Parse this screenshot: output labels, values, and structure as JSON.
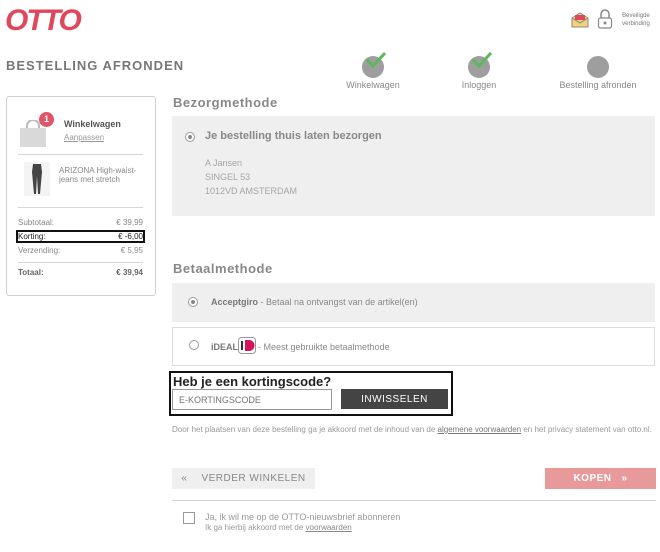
{
  "brand": {
    "logo_text": "OTTO",
    "color": "#e0475a"
  },
  "header": {
    "page_title": "BESTELLING AFRONDEN",
    "secure_label": "Beveiligde verbinding",
    "icons": [
      "mail-icon",
      "lock-icon"
    ]
  },
  "steps": [
    {
      "label": "Winkelwagen",
      "done": true
    },
    {
      "label": "Inloggen",
      "done": true
    },
    {
      "label": "Bestelling afronden",
      "done": false
    }
  ],
  "cart": {
    "badge": "1",
    "title": "Winkelwagen",
    "edit_link": "Aanpassen",
    "product": {
      "name": "ARIZONA High-waist-jeans met stretch"
    },
    "summary": [
      {
        "label": "Subtotaal:",
        "value": "€ 39,99"
      },
      {
        "label": "Korting:",
        "value": "€ -6,00"
      },
      {
        "label": "Verzending:",
        "value": "€ 5,95"
      }
    ],
    "total": {
      "label": "Totaal:",
      "value": "€ 39,94"
    }
  },
  "delivery": {
    "heading": "Bezorgmethode",
    "option_title": "Je bestelling thuis laten bezorgen",
    "address": [
      "A Jansen",
      "SINGEL 53",
      "1012VD AMSTERDAM"
    ]
  },
  "payment": {
    "heading": "Betaalmethode",
    "options": [
      {
        "name": "Acceptgiro",
        "desc": " - Betaal na ontvangst van de artikel(en)",
        "selected": true
      },
      {
        "name": "iDEAL",
        "desc": " - Meest gebruikte betaalmethode",
        "selected": false
      }
    ]
  },
  "coupon": {
    "title": "Heb je een kortingscode?",
    "placeholder": "E-KORTINGSCODE",
    "button": "INWISSELEN"
  },
  "terms": {
    "before": "Door het plaatsen van deze bestelling ga je akkoord met de inhoud van de ",
    "link": "algemene voorwaarden",
    "after": " en het privacy statement van otto.nl."
  },
  "actions": {
    "back": "VERDER WINKELEN",
    "buy": "KOPEN",
    "buy_color": "#e89a9a"
  },
  "newsletter": {
    "label": "Ja, ik wil me op de OTTO-nieuwsbrief abonneren",
    "sub_before": "Ik ga hierbij akkoord met de ",
    "sub_link": "voorwaarden"
  }
}
